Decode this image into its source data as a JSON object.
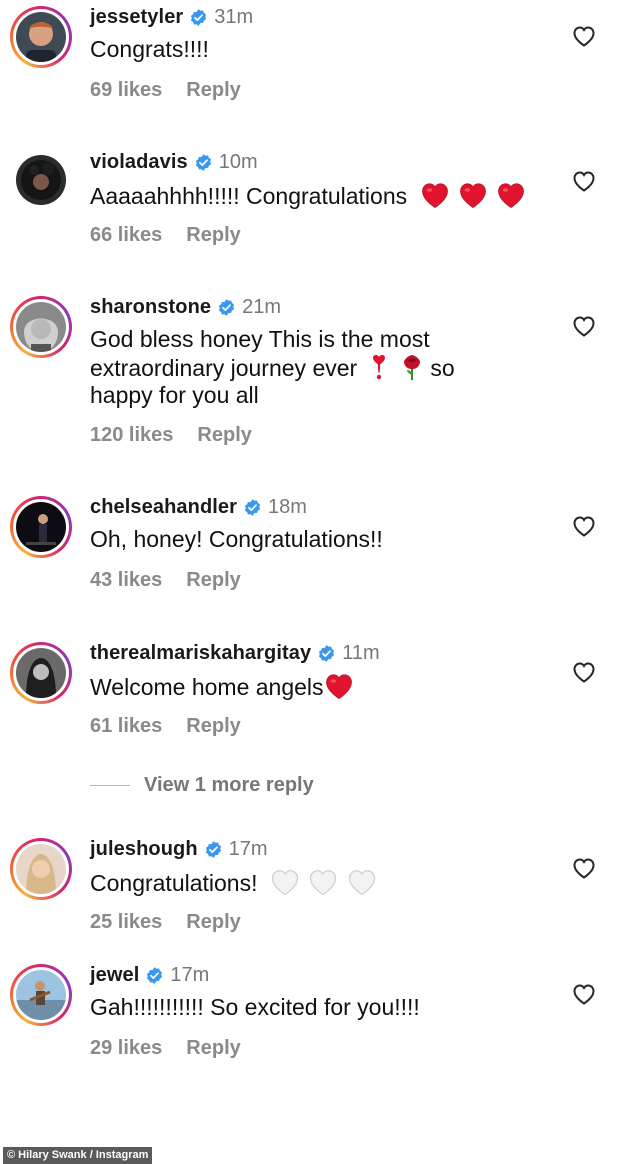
{
  "comments": [
    {
      "username": "jessetyler",
      "time": "31m",
      "text": "Congrats!!!!",
      "likes": "69 likes",
      "reply": "Reply"
    },
    {
      "username": "violadavis",
      "time": "10m",
      "text": "Aaaaahhhh!!!!! Congratulations",
      "likes": "66 likes",
      "reply": "Reply"
    },
    {
      "username": "sharonstone",
      "time": "21m",
      "text_line1": "God bless honey  This is the most",
      "text_line2": "extraordinary journey ever",
      "text_line2_end": "so",
      "text_line3": "happy for you all",
      "likes": "120 likes",
      "reply": "Reply"
    },
    {
      "username": "chelseahandler",
      "time": "18m",
      "text": "Oh, honey! Congratulations!!",
      "likes": "43 likes",
      "reply": "Reply"
    },
    {
      "username": "therealmariskahargitay",
      "time": "11m",
      "text": "Welcome home angels",
      "likes": "61 likes",
      "reply": "Reply"
    },
    {
      "username": "juleshough",
      "time": "17m",
      "text": "Congratulations!",
      "likes": "25 likes",
      "reply": "Reply"
    },
    {
      "username": "jewel",
      "time": "17m",
      "text": "Gah!!!!!!!!!!! So excited for you!!!!",
      "likes": "29 likes",
      "reply": "Reply"
    }
  ],
  "view_more_replies": "View 1 more reply",
  "credit": "© Hilary Swank / Instagram",
  "colors": {
    "verified": "#3897f0",
    "red_heart": "#e0142e",
    "white_heart": "#f4f4f4",
    "muted": "#8a8a8a"
  },
  "icons": {
    "like": "heart-outline-icon",
    "verified": "verified-badge-icon"
  }
}
